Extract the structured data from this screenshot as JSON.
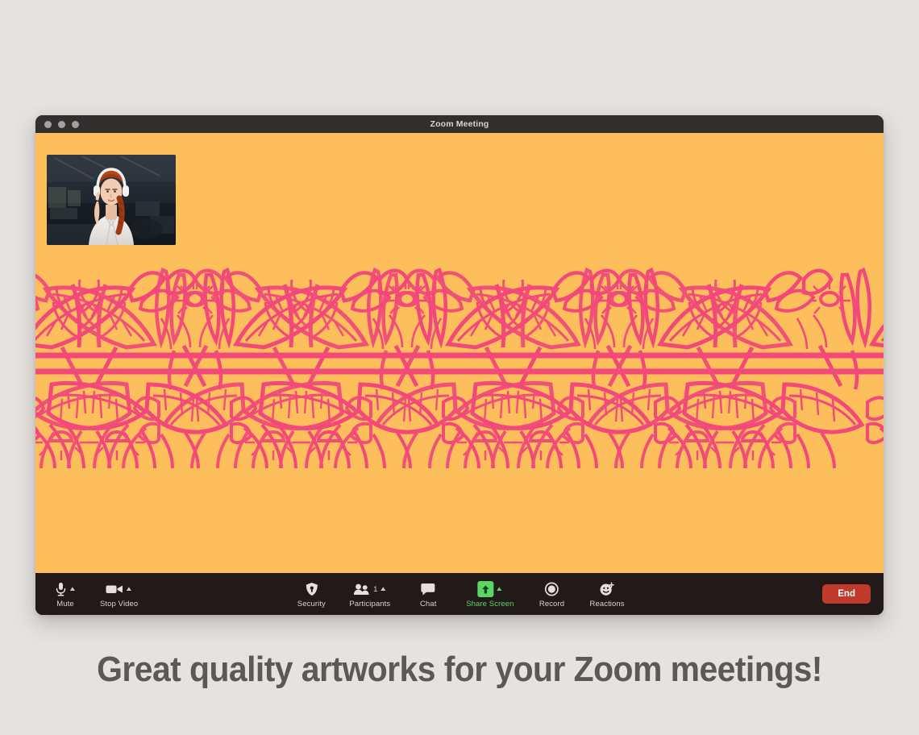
{
  "page": {
    "background_color": "#E5E2DF",
    "caption": "Great quality artworks for your Zoom meetings!",
    "caption_color": "#5C5955"
  },
  "window": {
    "title": "Zoom Meeting",
    "titlebar_color": "#32302F",
    "frame_color": "#211A18",
    "traffic_lights": [
      "close",
      "minimize",
      "zoom"
    ]
  },
  "stage": {
    "background_color": "#FCBF5C",
    "artwork": {
      "name": "floral-botanical-band",
      "style": "william-morris-line-art",
      "line_color": "#F2487A",
      "background_color": "#FCBF5C"
    },
    "self_view": {
      "label": "self-view-thumbnail",
      "description": "woman with red hair wearing headphones in dark office"
    }
  },
  "toolbar": {
    "background_color": "#211A18",
    "accent_color": "#5BD665",
    "left_items": [
      {
        "id": "mute",
        "label": "Mute",
        "icon": "microphone-icon",
        "has_caret": true
      },
      {
        "id": "video",
        "label": "Stop Video",
        "icon": "video-camera-icon",
        "has_caret": true
      }
    ],
    "center_items": [
      {
        "id": "security",
        "label": "Security",
        "icon": "shield-icon",
        "has_caret": false
      },
      {
        "id": "participants",
        "label": "Participants",
        "icon": "people-icon",
        "has_caret": true,
        "count": "1"
      },
      {
        "id": "chat",
        "label": "Chat",
        "icon": "chat-bubble-icon",
        "has_caret": false
      },
      {
        "id": "share",
        "label": "Share Screen",
        "icon": "share-arrow-icon",
        "has_caret": true,
        "accent": true
      },
      {
        "id": "record",
        "label": "Record",
        "icon": "record-circle-icon",
        "has_caret": false
      },
      {
        "id": "reactions",
        "label": "Reactions",
        "icon": "smiley-plus-icon",
        "has_caret": false
      }
    ],
    "end_button": {
      "label": "End",
      "color": "#C0392B"
    }
  }
}
